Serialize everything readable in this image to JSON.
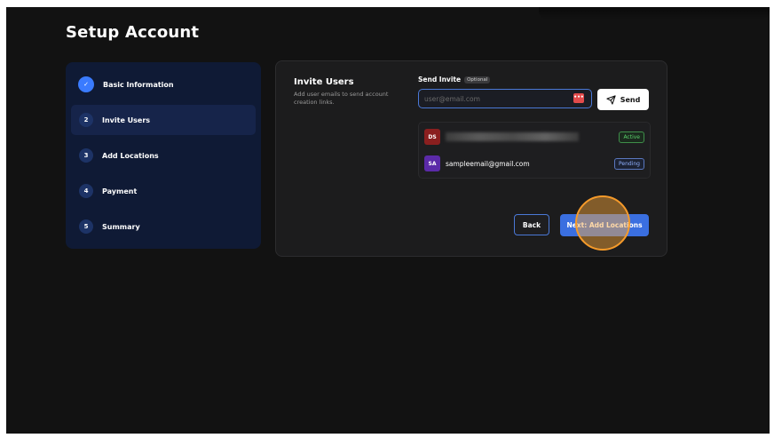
{
  "page": {
    "title": "Setup Account"
  },
  "steps": [
    {
      "num": "✓",
      "label": "Basic Information"
    },
    {
      "num": "2",
      "label": "Invite Users"
    },
    {
      "num": "3",
      "label": "Add Locations"
    },
    {
      "num": "4",
      "label": "Payment"
    },
    {
      "num": "5",
      "label": "Summary"
    }
  ],
  "invite": {
    "title": "Invite Users",
    "description": "Add user emails to send account creation links.",
    "send_label": "Send Invite",
    "optional_badge": "Optional",
    "email_placeholder": "user@email.com",
    "password_icon": "•••",
    "send_button": "Send"
  },
  "users": [
    {
      "initials": "DS",
      "email": "",
      "status": "Active",
      "avatar_color": "#8a1f1f"
    },
    {
      "initials": "SA",
      "email": "sampleemail@gmail.com",
      "status": "Pending",
      "avatar_color": "#5b2aa8"
    }
  ],
  "actions": {
    "back": "Back",
    "next": "Next: Add Locations"
  },
  "colors": {
    "accent": "#3a6fe0",
    "sidebar_bg": "#0f1a35",
    "click_indicator": "#f59a2a"
  }
}
